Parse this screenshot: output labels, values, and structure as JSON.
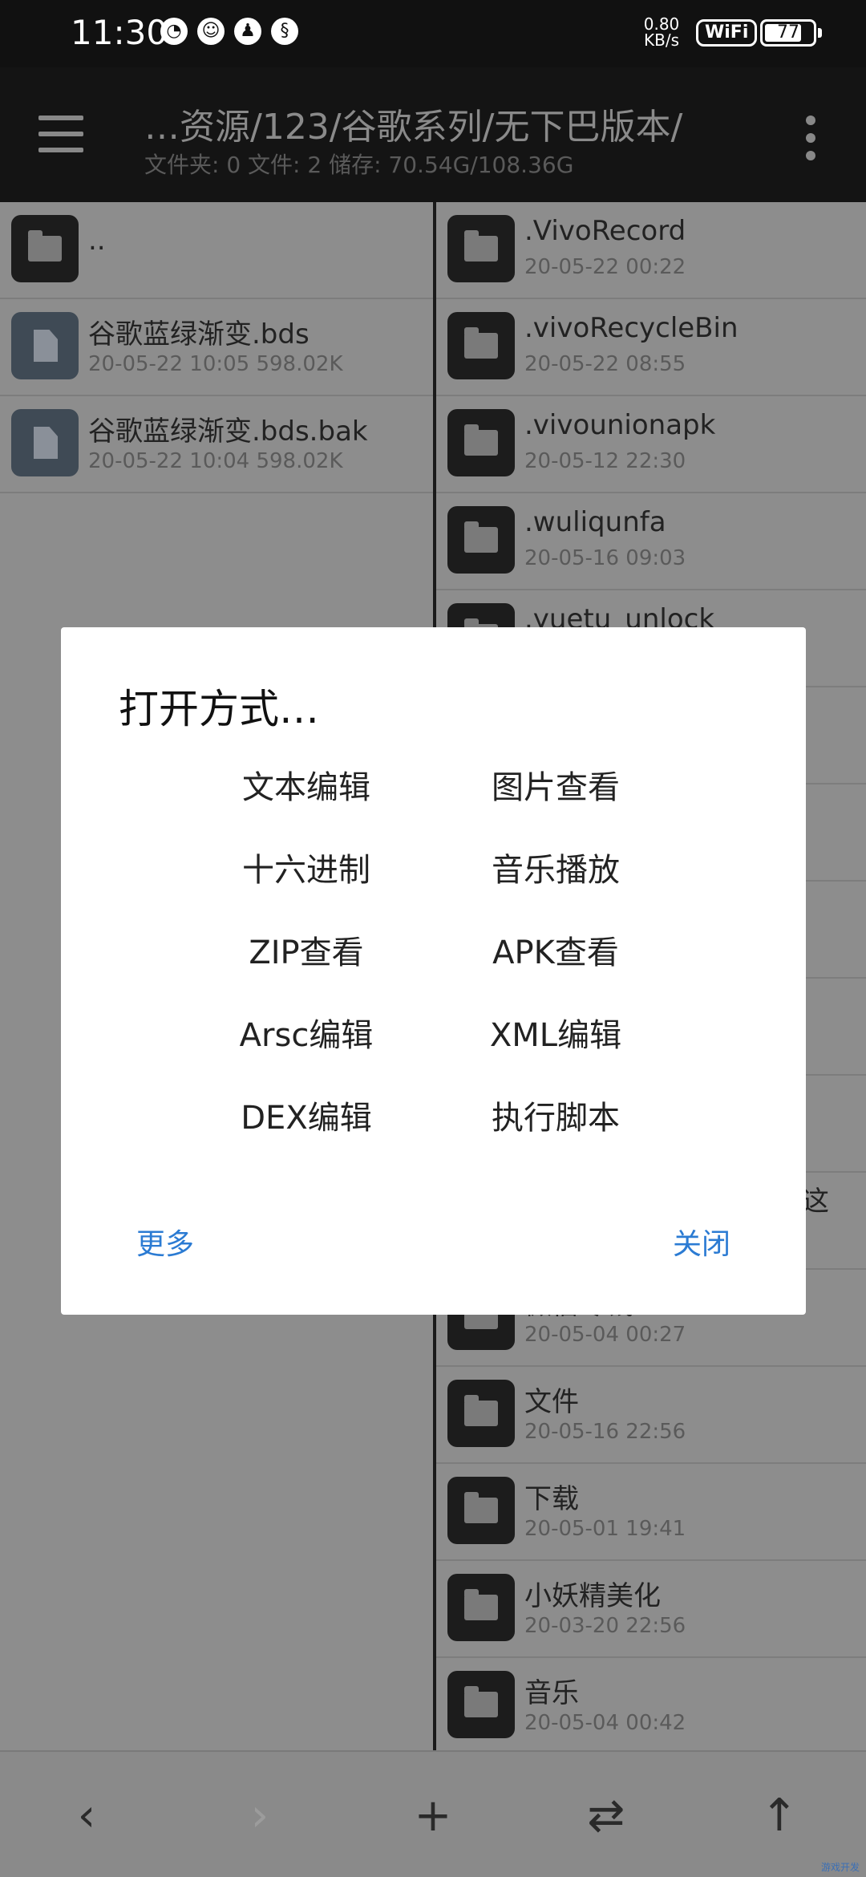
{
  "status_bar": {
    "time": "11:30",
    "net_speed_value": "0.80",
    "net_speed_unit": "KB/s",
    "wifi_label": "WiFi",
    "battery": "77",
    "battery_level": 0.77
  },
  "toolbar": {
    "path": "…资源/123/谷歌系列/无下巴版本/",
    "stats": "文件夹: 0  文件: 2  储存: 70.54G/108.36G"
  },
  "left_pane": {
    "items": [
      {
        "name": "..",
        "meta": "",
        "type": "folder"
      },
      {
        "name": "谷歌蓝绿渐变.bds",
        "meta": "20-05-22 10:05  598.02K",
        "type": "file"
      },
      {
        "name": "谷歌蓝绿渐变.bds.bak",
        "meta": "20-05-22 10:04  598.02K",
        "type": "file"
      }
    ]
  },
  "right_pane": {
    "items": [
      {
        "name": ".VivoRecord",
        "meta": "20-05-22 00:22"
      },
      {
        "name": ".vivoRecycleBin",
        "meta": "20-05-22 08:55"
      },
      {
        "name": ".vivounionapk",
        "meta": "20-05-12 22:30"
      },
      {
        "name": ".wuliqunfa",
        "meta": "20-05-16 09:03"
      },
      {
        "name": ".yuetu_unlock",
        "meta": ""
      },
      {
        "name": "",
        "meta": ""
      },
      {
        "name": "",
        "meta": ""
      },
      {
        "name": "",
        "meta": ""
      },
      {
        "name": "",
        "meta": ""
      },
      {
        "name": "",
        "meta": ""
      },
      {
        "name": "",
        "meta": ""
      },
      {
        "name": "微信零钱",
        "meta": "20-05-04 00:27"
      },
      {
        "name": "文件",
        "meta": "20-05-16 22:56"
      },
      {
        "name": "下载",
        "meta": "20-05-01 19:41"
      },
      {
        "name": "小妖精美化",
        "meta": "20-03-20 22:56"
      },
      {
        "name": "音乐",
        "meta": "20-05-04 00:42"
      }
    ],
    "partial_text": "这"
  },
  "dialog": {
    "title": "打开方式…",
    "options": [
      "文本编辑",
      "图片查看",
      "十六进制",
      "音乐播放",
      "ZIP查看",
      "APK查看",
      "Arsc编辑",
      "XML编辑",
      "DEX编辑",
      "执行脚本"
    ],
    "more_label": "更多",
    "close_label": "关闭"
  },
  "bottom_bar": {
    "back": "‹",
    "forward": "›",
    "add": "+",
    "swap": "⇄",
    "up": "↑"
  },
  "watermark": "游戏开发"
}
